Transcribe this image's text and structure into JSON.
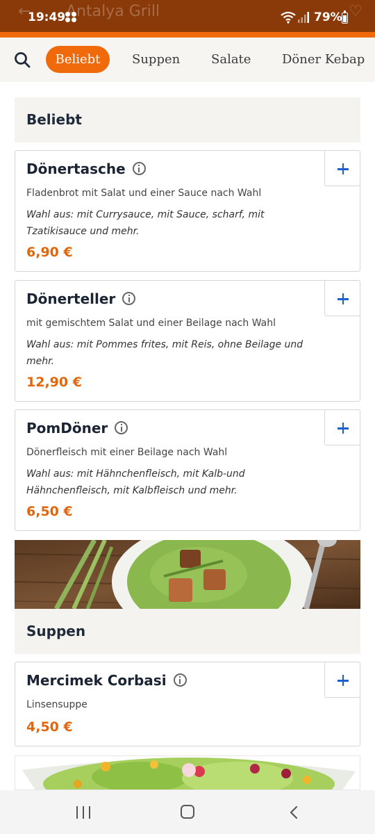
{
  "status_bar": {
    "time": "19:49",
    "battery": "79%",
    "app_title_faded": "Antalya Grill"
  },
  "category_nav": {
    "active": "Beliebt",
    "tabs": [
      "Suppen",
      "Salate",
      "Döner Kebap"
    ]
  },
  "sections": {
    "beliebt": {
      "title": "Beliebt"
    },
    "suppen": {
      "title": "Suppen"
    }
  },
  "items": [
    {
      "name": "Dönertasche",
      "description": "Fladenbrot mit Salat und einer Sauce nach Wahl",
      "choice_line1": "Wahl aus: mit Currysauce, mit Sauce, scharf, mit",
      "choice_line2": "Tzatikisauce und mehr.",
      "price": "6,90 €"
    },
    {
      "name": "Dönerteller",
      "description": "mit gemischtem Salat und einer Beilage nach Wahl",
      "choice_line1": "Wahl aus: mit Pommes frites, mit Reis, ohne Beilage und",
      "choice_line2": "mehr.",
      "price": "12,90 €"
    },
    {
      "name": "PomDöner",
      "description": "Dönerfleisch mit einer Beilage nach Wahl",
      "choice_line1": "Wahl aus: mit Hähnchenfleisch, mit Kalb-und",
      "choice_line2": "Hähnchenfleisch, mit Kalbfleisch und mehr.",
      "price": "6,50 €"
    },
    {
      "name": "Mercimek Corbasi",
      "description": "Linsensuppe",
      "price": "4,50 €"
    }
  ],
  "colors": {
    "accent": "#f06a0c",
    "price": "#e2660b",
    "add_icon": "#1a5fd0",
    "header": "#8a3a08"
  }
}
